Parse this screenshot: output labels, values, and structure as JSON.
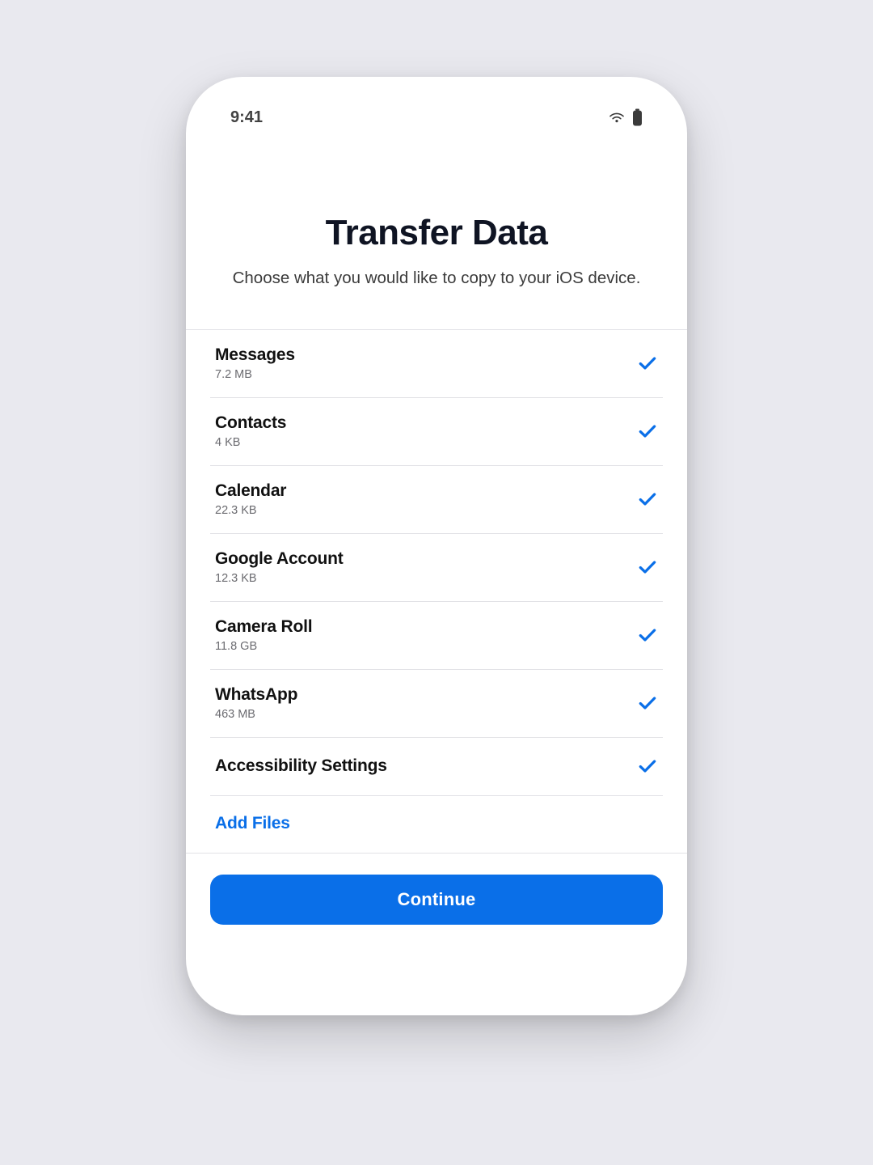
{
  "status": {
    "time": "9:41"
  },
  "header": {
    "title": "Transfer Data",
    "subtitle": "Choose what you would like to copy to your iOS device."
  },
  "items": [
    {
      "title": "Messages",
      "size": "7.2 MB",
      "selected": true
    },
    {
      "title": "Contacts",
      "size": "4 KB",
      "selected": true
    },
    {
      "title": "Calendar",
      "size": "22.3 KB",
      "selected": true
    },
    {
      "title": "Google Account",
      "size": "12.3 KB",
      "selected": true
    },
    {
      "title": "Camera Roll",
      "size": "11.8 GB",
      "selected": true
    },
    {
      "title": "WhatsApp",
      "size": "463 MB",
      "selected": true
    },
    {
      "title": "Accessibility Settings",
      "size": null,
      "selected": true
    }
  ],
  "actions": {
    "add_files": "Add Files",
    "continue": "Continue"
  },
  "colors": {
    "accent": "#0a6fe8"
  }
}
